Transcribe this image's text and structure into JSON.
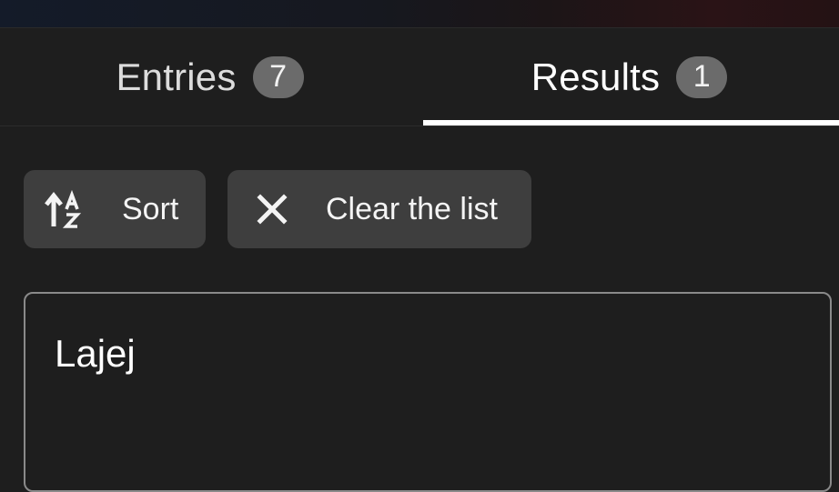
{
  "tabs": {
    "entries": {
      "label": "Entries",
      "count": "7"
    },
    "results": {
      "label": "Results",
      "count": "1",
      "selected": true
    }
  },
  "toolbar": {
    "sort_label": "Sort",
    "sort_icon": "sort-alphabetical-ascending-icon",
    "clear_label": "Clear the list",
    "clear_icon": "close-icon"
  },
  "results": {
    "items": [
      "Lajej"
    ]
  },
  "colors": {
    "background": "#1e1e1e",
    "button_bg": "#3e3e3e",
    "badge_bg": "#6b6b6b",
    "indicator": "#ffffff",
    "card_border": "#8a8a8a"
  }
}
